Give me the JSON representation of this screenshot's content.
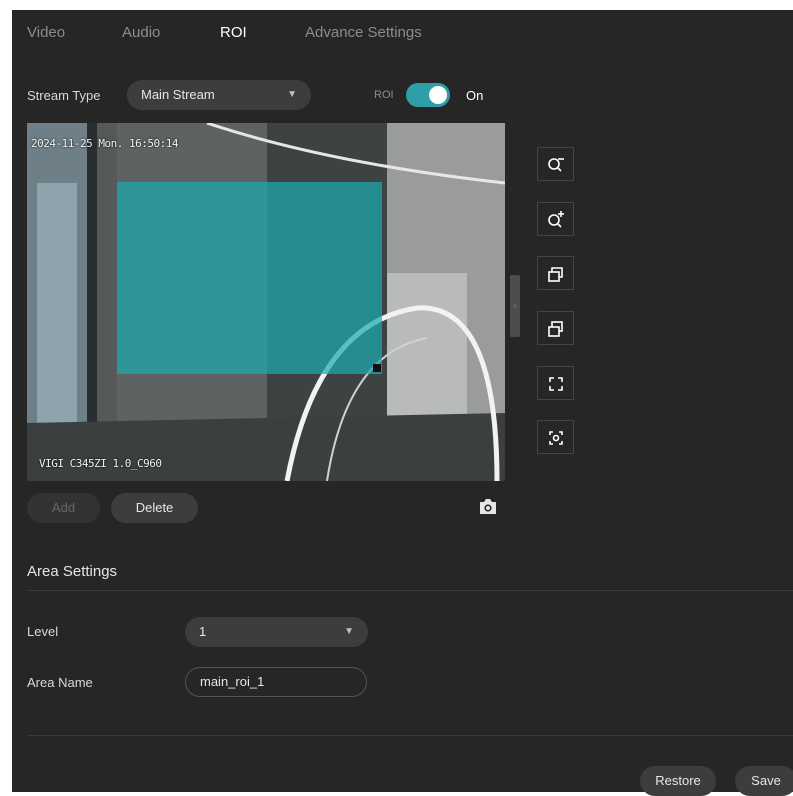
{
  "tabs": [
    {
      "label": "Video",
      "active": false
    },
    {
      "label": "Audio",
      "active": false
    },
    {
      "label": "ROI",
      "active": true
    },
    {
      "label": "Advance Settings",
      "active": false
    }
  ],
  "stream": {
    "label": "Stream Type",
    "value": "Main Stream"
  },
  "roi_toggle": {
    "label": "ROI",
    "state": "On",
    "enabled": true,
    "color": "#2e9ea8"
  },
  "video": {
    "timestamp": "2024-11-25 Mon. 16:50:14",
    "camera_label": "VIGI C345ZI 1.0_C960"
  },
  "toolbar": {
    "icons": [
      "zoom-out-icon",
      "zoom-in-icon",
      "bring-forward-icon",
      "send-backward-icon",
      "fullscreen-icon",
      "center-focus-icon"
    ]
  },
  "actions": {
    "add": "Add",
    "delete": "Delete",
    "snapshot_icon": "camera-icon"
  },
  "area_settings": {
    "title": "Area Settings",
    "level_label": "Level",
    "level_value": "1",
    "area_name_label": "Area Name",
    "area_name_value": "main_roi_1"
  },
  "footer": {
    "restore": "Restore",
    "save": "Save"
  },
  "colors": {
    "accent": "#2e9ea8",
    "panel": "#262626",
    "roi_fill": "#1caaaf"
  }
}
